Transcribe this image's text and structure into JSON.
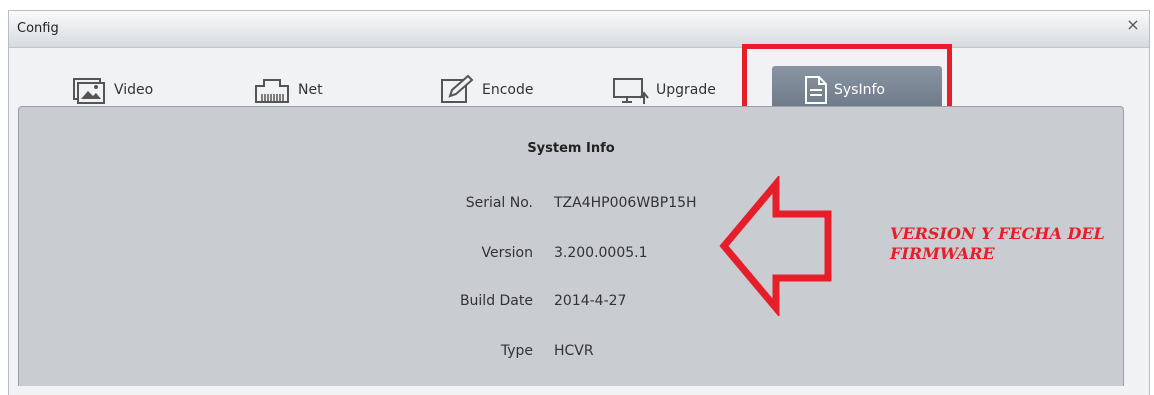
{
  "window": {
    "title": "Config",
    "close_glyph": "×"
  },
  "tabs": [
    {
      "label": "Video",
      "icon": "video-icon"
    },
    {
      "label": "Net",
      "icon": "network-icon"
    },
    {
      "label": "Encode",
      "icon": "edit-icon"
    },
    {
      "label": "Upgrade",
      "icon": "monitor-upgrade-icon"
    },
    {
      "label": "SysInfo",
      "icon": "document-icon",
      "active": true
    }
  ],
  "sysinfo": {
    "title": "System Info",
    "fields": [
      {
        "label": "Serial No.",
        "value": "TZA4HP006WBP15H"
      },
      {
        "label": "Version",
        "value": "3.200.0005.1"
      },
      {
        "label": "Build Date",
        "value": "2014-4-27"
      },
      {
        "label": "Type",
        "value": "HCVR"
      }
    ]
  },
  "annotation": {
    "line1": "VERSION Y FECHA DEL",
    "line2": "FIRMWARE",
    "color": "#e61e2a"
  },
  "colors": {
    "panel_bg": "#c9ccd0",
    "active_tab": "#7a8593",
    "highlight": "#e61e2a"
  }
}
